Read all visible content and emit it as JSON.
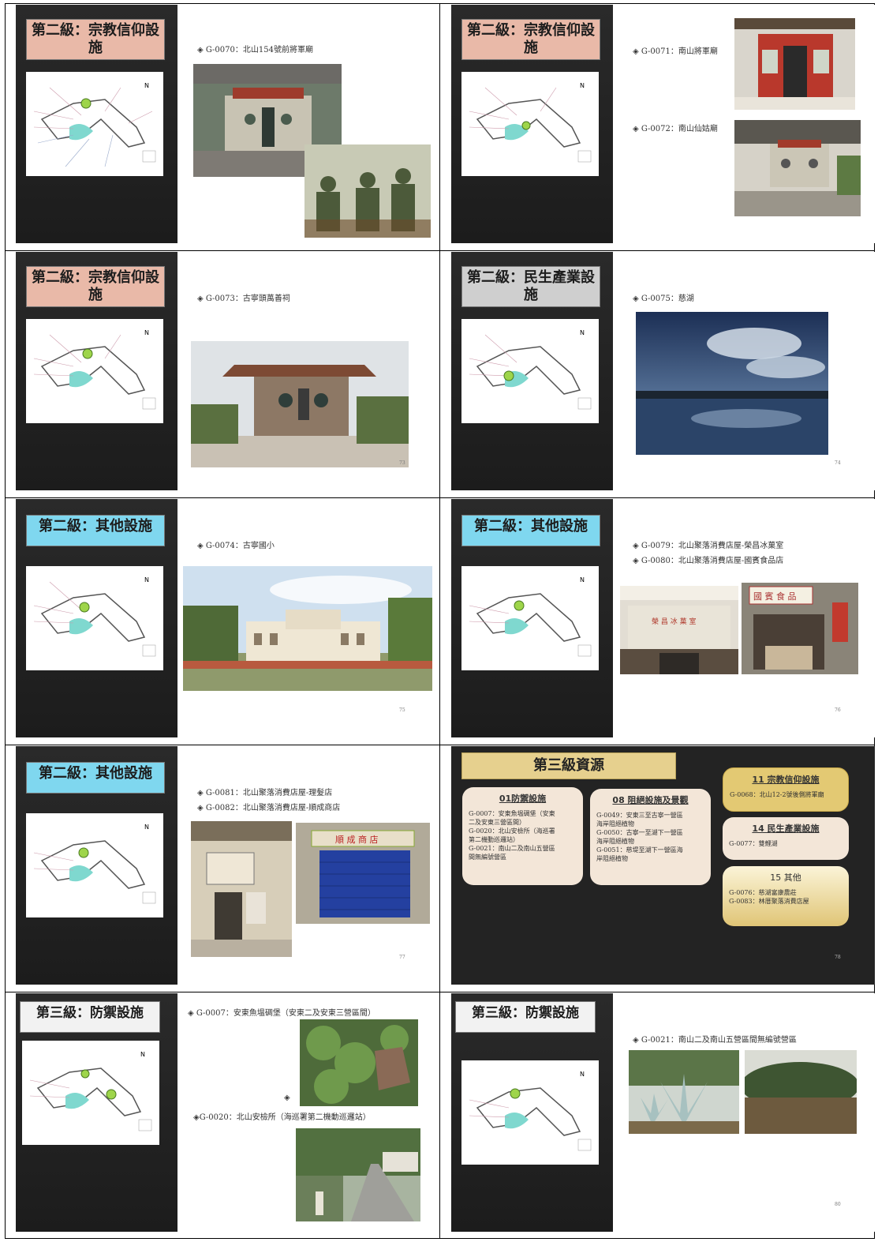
{
  "slides": [
    {
      "title": "第二級：宗教信仰設施",
      "captions": [
        "◈ G-0070：北山154號前將軍廟"
      ],
      "page": ""
    },
    {
      "title": "第二級：宗教信仰設施",
      "captions": [
        "◈ G-0071：南山將軍廟",
        "◈ G-0072：南山仙姑廟"
      ],
      "page": ""
    },
    {
      "title": "第二級：宗教信仰設施",
      "captions": [
        "◈ G-0073：古寧頭萬善祠"
      ],
      "page": "73"
    },
    {
      "title": "第二級：民生產業設施",
      "captions": [
        "◈ G-0075：慈湖"
      ],
      "page": "74"
    },
    {
      "title": "第二級：其他設施",
      "captions": [
        "◈ G-0074：古寧國小"
      ],
      "page": "75"
    },
    {
      "title": "第二級：其他設施",
      "captions": [
        "◈ G-0079：北山聚落消費店屋-榮昌冰菓室",
        "◈ G-0080：北山聚落消費店屋-國賓食品店"
      ],
      "page": "76"
    },
    {
      "title": "第二級：其他設施",
      "captions": [
        "◈ G-0081：北山聚落消費店屋-理髮店",
        "◈ G-0082：北山聚落消費店屋-順成商店"
      ],
      "page": "77"
    },
    {
      "title": "第三級資源",
      "page": "78",
      "cards": [
        {
          "title": "01防禦設施",
          "body": "G-0007：安東魚塭碉堡（安東\n二及安東三營區間）\nG-0020：北山安檢所（海巡署\n第二機動巡邏站）\nG-0021：南山二及南山五營區\n間無編號營區"
        },
        {
          "title": "08 阻絕設施及景觀",
          "body": "G-0049：安東三至古寧一營區\n海岸阻絕植物\nG-0050：古寧一至湖下一營區\n海岸阻絕植物\nG-0051：慈堤至湖下一營區海\n岸阻絕植物"
        },
        {
          "title": "11 宗教信仰設施",
          "body": "G-0068：北山12-2號後側將軍廟"
        },
        {
          "title": "14 民生產業設施",
          "body": "G-0077：雙鯉湖"
        },
        {
          "title": "15 其他",
          "body": "G-0076：慈湖富康農莊\nG-0083：林厝聚落消費店屋"
        }
      ]
    },
    {
      "title": "第三級：防禦設施",
      "captions": [
        "◈ G-0007：安東魚塭碉堡（安東二及安東三營區間）",
        "◈",
        "◈G-0020：北山安檢所（海巡署第二機動巡邏站）"
      ],
      "page": ""
    },
    {
      "title": "第三級：防禦設施",
      "captions": [
        "◈ G-0021：南山二及南山五營區間無編號營區"
      ],
      "page": "80"
    }
  ]
}
